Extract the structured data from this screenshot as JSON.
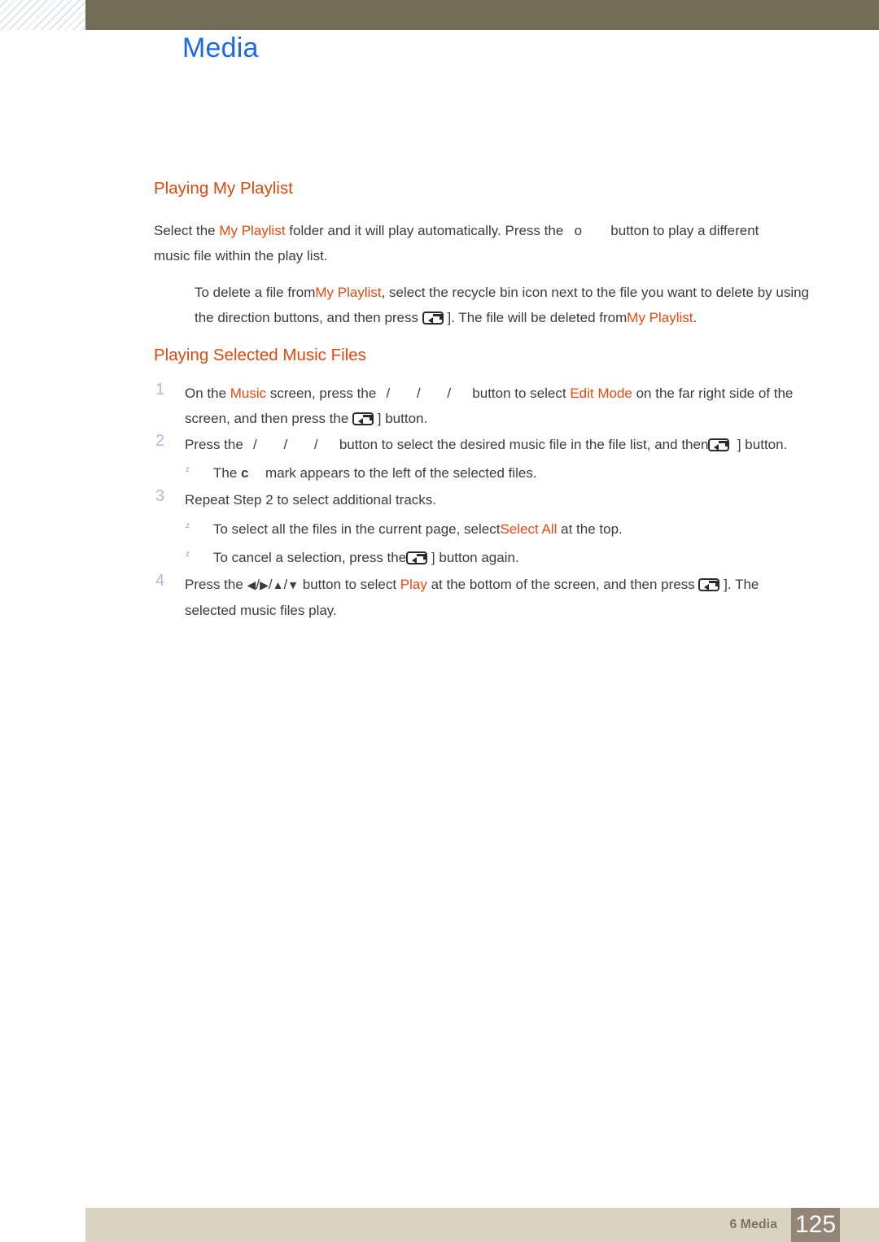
{
  "header": {
    "chapter_number": "6",
    "title": "Media",
    "bar_color": "#716d57",
    "title_color": "#1a6ae8"
  },
  "accent_color": "#e8490d",
  "sections": [
    {
      "heading": "Playing My Playlist",
      "paragraph": {
        "part1": "Select the ",
        "link1": "My Playlist",
        "part2": " folder and it will play automatically. Press the",
        "glyph": "o",
        "part3": "button to play a different",
        "line2": "music file within the play list."
      },
      "note": {
        "line1_a": "To delete a file from",
        "line1_link": "My Playlist",
        "line1_b": ", select the recycle bin icon next to the file you want to delete by using",
        "line2_a": "the direction buttons, and then press",
        "line2_icon": "enter-key-icon",
        "line2_b": "]. The file will be deleted from",
        "line2_link": "My Playlist",
        "line2_c": "."
      }
    },
    {
      "heading": "Playing Selected Music Files",
      "steps": [
        {
          "number": "1",
          "line1_a": "On the ",
          "line1_link": "Music",
          "line1_b": " screen, press the",
          "line1_arrows": "/      /      /",
          "line1_c": "button to select ",
          "line1_link2": "Edit Mode",
          "line1_d": " on the far right side of the",
          "line2_a": "screen, and then press the",
          "line2_icon": "enter-key-icon",
          "line2_b": "] button.",
          "bullets": []
        },
        {
          "number": "2",
          "line1_a": "Press the",
          "line1_arrows": "/      /      /",
          "line1_b": "button to select the desired music file in the file list, and then",
          "line1_icon": "enter-key-icon",
          "line1_c": "] button.",
          "bullets": [
            {
              "marker": "z",
              "text_a": "The ",
              "mark": "c",
              "text_b": "mark appears to the left of the selected files."
            }
          ]
        },
        {
          "number": "3",
          "line1_a": "Repeat Step 2 to select additional tracks.",
          "bullets": [
            {
              "marker": "z",
              "text_a": "To select all the files in the current page, select",
              "link": "Select All",
              "text_b": " at the top."
            },
            {
              "marker": "z",
              "text_a": "To cancel a selection, press the",
              "icon": "enter-key-icon",
              "text_b": "] button again."
            }
          ]
        },
        {
          "number": "4",
          "line1_a": "Press the ",
          "arrow_left": "◀",
          "arrow_right": "▶",
          "arrow_up": "▲",
          "arrow_down": "▼",
          "sep": "/",
          "line1_b": " button to select ",
          "line1_link": "Play",
          "line1_c": " at the bottom of the screen, and then press",
          "line1_icon": "enter-key-icon",
          "line1_d": "]. The",
          "line2": "selected music files play.",
          "bullets": []
        }
      ]
    }
  ],
  "footer": {
    "chapter_label": "6 Media",
    "page_number": "125",
    "bar_color": "#d8d4c0",
    "page_box_color": "#938577"
  }
}
